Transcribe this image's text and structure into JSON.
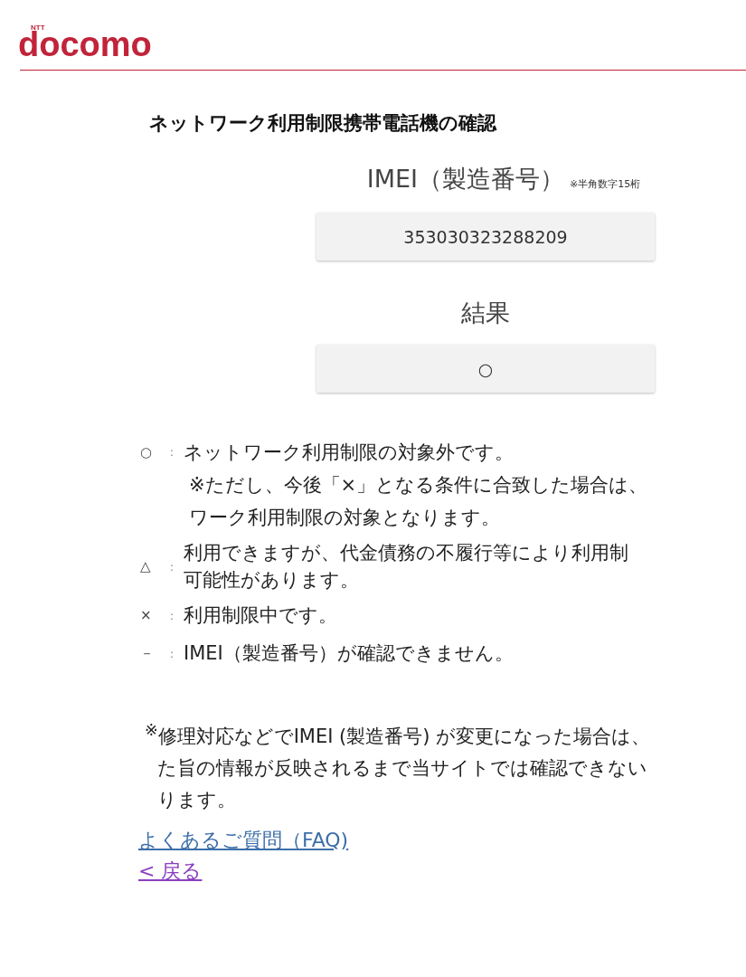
{
  "header": {
    "logo_small": "NTT",
    "logo": "docomo"
  },
  "title": "ネットワーク利用制限携帯電話機の確認",
  "imei": {
    "label": "IMEI（製造番号）",
    "hint": "※半角数字15桁",
    "value": "353030323288209"
  },
  "result": {
    "label": "結果",
    "value": "○"
  },
  "legend": [
    {
      "symbol": "○",
      "separator": ":",
      "lines": [
        "ネットワーク利用制限の対象外です。"
      ],
      "note_lines": [
        "※ただし、今後「×」となる条件に合致した場合は、",
        "ワーク利用制限の対象となります。"
      ]
    },
    {
      "symbol": "△",
      "separator": ":",
      "lines": [
        "利用できますが、代金債務の不履行等により利用制",
        "可能性があります。"
      ]
    },
    {
      "symbol": "×",
      "separator": ":",
      "lines": [
        "利用制限中です。"
      ]
    },
    {
      "symbol": "－",
      "separator": ":",
      "lines": [
        "IMEI（製造番号）が確認できません。"
      ]
    }
  ],
  "footnote_lines": [
    "$^{※}$修理対応などでIMEI (製造番号) が変更になった場合は、",
    "た旨の情報が反映されるまで当サイトでは確認できない",
    "ります。"
  ],
  "links": [
    {
      "text": "よくあるご質問（FAQ)",
      "visited": false
    },
    {
      "text": "< 戻る",
      "visited": true
    }
  ]
}
